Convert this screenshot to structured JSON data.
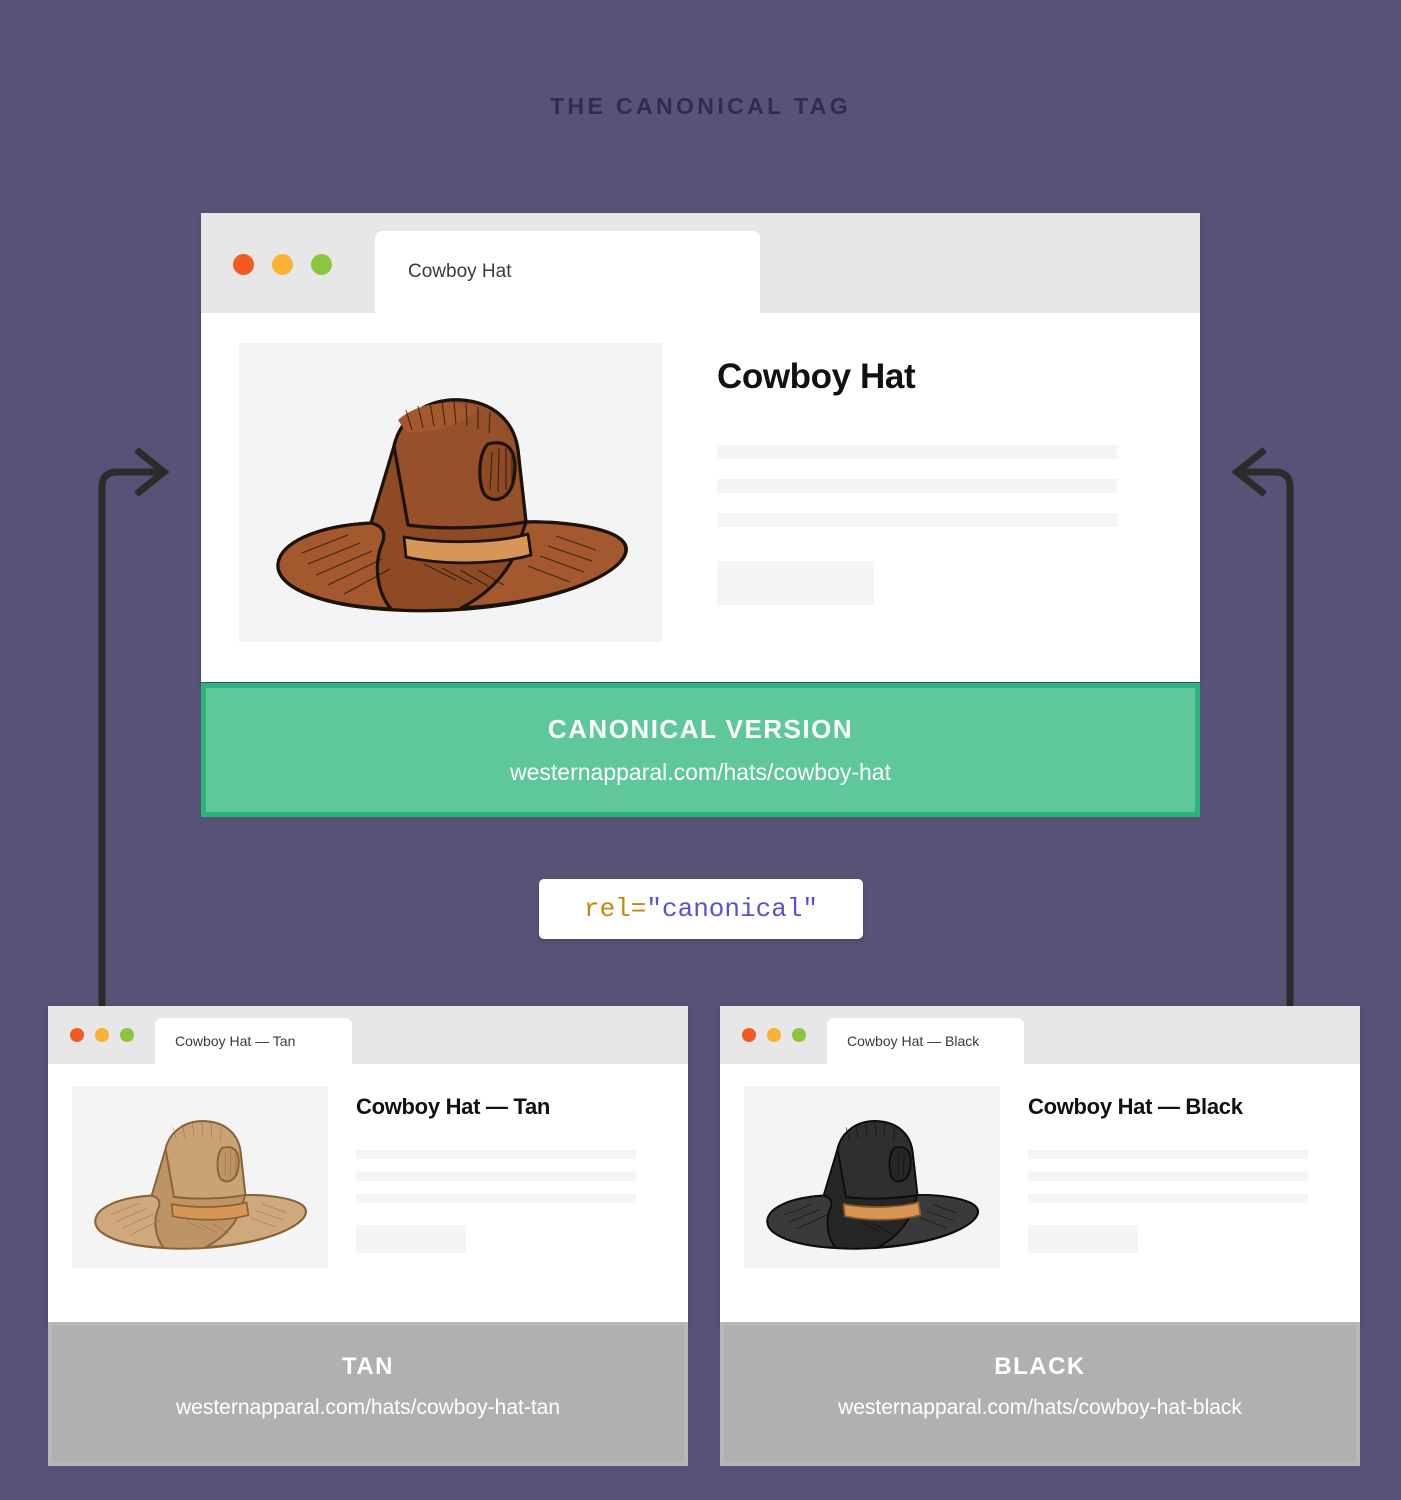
{
  "page": {
    "title": "THE CANONICAL TAG",
    "background_color": "#585276",
    "title_color": "#312b52"
  },
  "code_badge": {
    "attribute": "rel=",
    "value": "\"canonical\"",
    "attribute_color": "#c8860a",
    "value_color": "#5a52d5"
  },
  "canonical_window": {
    "tab_label": "Cowboy Hat",
    "product_title": "Cowboy Hat",
    "hat_color": "brown",
    "traffic_lights": [
      "red-dot",
      "yellow-dot",
      "green-dot"
    ],
    "banner": {
      "label": "CANONICAL VERSION",
      "url": "westernapparal.com/hats/cowboy-hat",
      "fill_color": "#5ec89a",
      "border_color": "#2bb47d"
    }
  },
  "variants": [
    {
      "id": "tan",
      "tab_label": "Cowboy Hat — Tan",
      "product_title": "Cowboy Hat — Tan",
      "hat_color": "tan",
      "banner": {
        "label": "TAN",
        "url": "westernapparal.com/hats/cowboy-hat-tan",
        "fill_color": "#b0b0b0"
      }
    },
    {
      "id": "black",
      "tab_label": "Cowboy Hat — Black",
      "product_title": "Cowboy Hat — Black",
      "hat_color": "black",
      "banner": {
        "label": "BLACK",
        "url": "westernapparal.com/hats/cowboy-hat-black",
        "fill_color": "#b0b0b0"
      }
    }
  ],
  "connectors": {
    "arrow_color": "#2b2b2b",
    "left_arrow": "tan-variant-points-to-canonical",
    "right_arrow": "black-variant-points-to-canonical"
  }
}
